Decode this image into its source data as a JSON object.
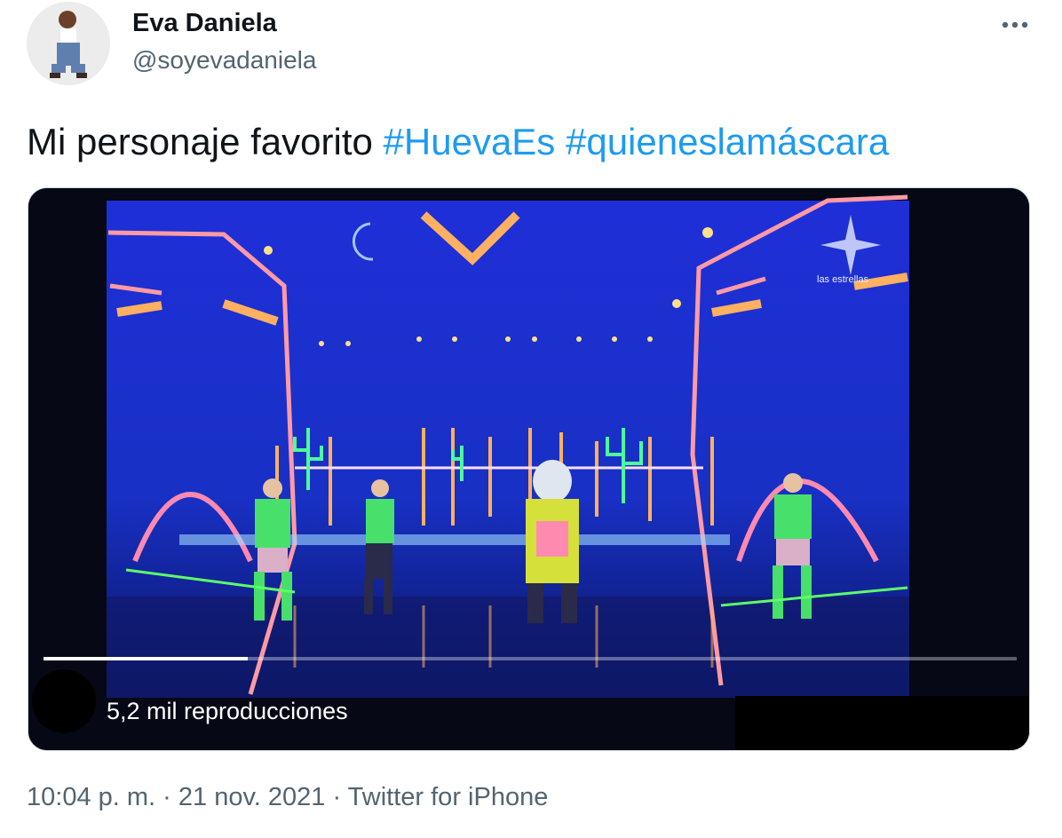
{
  "author": {
    "display_name": "Eva Daniela",
    "handle": "@soyevadaniela"
  },
  "tweet": {
    "text": "Mi personaje favorito",
    "hashtags": [
      "#HuevaEs",
      "#quieneslamáscara"
    ]
  },
  "video": {
    "views": "5,2 mil reproducciones",
    "progress_fraction": 0.21,
    "channel_watermark": "las estrellas"
  },
  "meta": {
    "time": "10:04 p. m.",
    "separator": " · ",
    "date": "21 nov. 2021",
    "source": "Twitter for iPhone"
  },
  "icons": {
    "more": "more-horizontal-icon"
  },
  "colors": {
    "link": "#1d9bf0",
    "secondary_text": "#536471",
    "primary_text": "#0f1419"
  }
}
